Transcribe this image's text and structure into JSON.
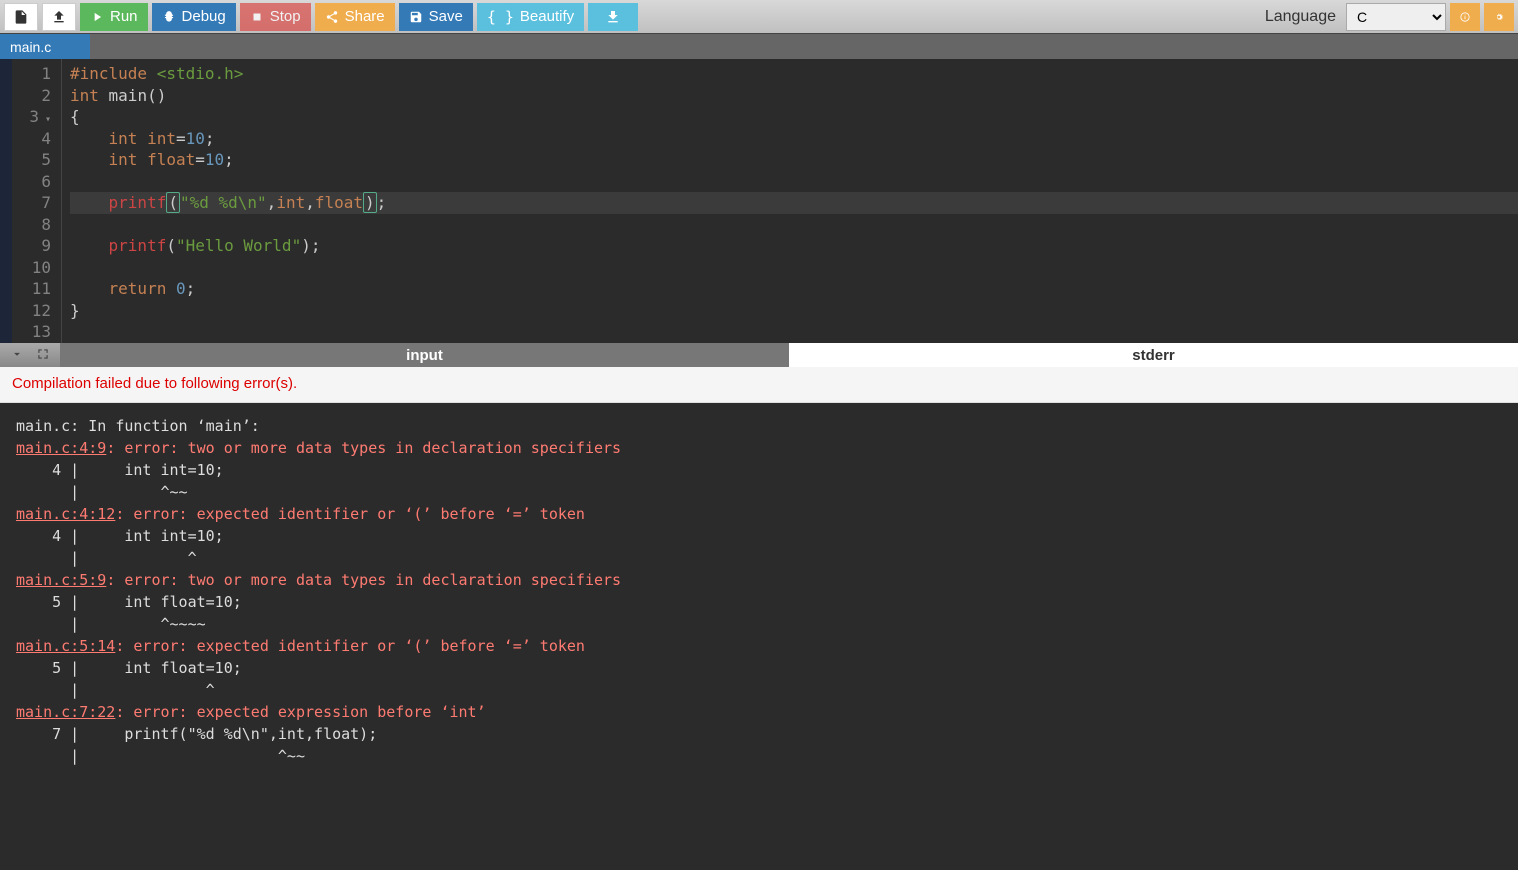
{
  "toolbar": {
    "run": "Run",
    "debug": "Debug",
    "stop": "Stop",
    "share": "Share",
    "save": "Save",
    "beautify": "Beautify",
    "language_label": "Language",
    "language_value": "C"
  },
  "tabs": {
    "file": "main.c"
  },
  "editor": {
    "line_numbers": [
      "1",
      "2",
      "3",
      "4",
      "5",
      "6",
      "7",
      "8",
      "9",
      "10",
      "11",
      "12",
      "13"
    ],
    "code_tokens": [
      [
        {
          "t": "#include",
          "c": "tok-pp"
        },
        {
          "t": " ",
          "c": ""
        },
        {
          "t": "<stdio.h>",
          "c": "tok-include"
        }
      ],
      [
        {
          "t": "int",
          "c": "tok-kw"
        },
        {
          "t": " main()",
          "c": ""
        }
      ],
      [
        {
          "t": "{",
          "c": ""
        }
      ],
      [
        {
          "t": "    ",
          "c": ""
        },
        {
          "t": "int",
          "c": "tok-kw"
        },
        {
          "t": " ",
          "c": ""
        },
        {
          "t": "int",
          "c": "tok-kw"
        },
        {
          "t": "=",
          "c": ""
        },
        {
          "t": "10",
          "c": "tok-num"
        },
        {
          "t": ";",
          "c": ""
        }
      ],
      [
        {
          "t": "    ",
          "c": ""
        },
        {
          "t": "int",
          "c": "tok-kw"
        },
        {
          "t": " ",
          "c": ""
        },
        {
          "t": "float",
          "c": "tok-kw"
        },
        {
          "t": "=",
          "c": ""
        },
        {
          "t": "10",
          "c": "tok-num"
        },
        {
          "t": ";",
          "c": ""
        }
      ],
      [],
      [
        {
          "t": "    ",
          "c": ""
        },
        {
          "t": "printf",
          "c": "tok-fn"
        },
        {
          "t": "(",
          "c": "paren-hl"
        },
        {
          "t": "\"%d %d\\n\"",
          "c": "tok-str"
        },
        {
          "t": ",",
          "c": ""
        },
        {
          "t": "int",
          "c": "tok-kw"
        },
        {
          "t": ",",
          "c": ""
        },
        {
          "t": "float",
          "c": "tok-kw"
        },
        {
          "t": ")",
          "c": "paren-hl"
        },
        {
          "t": ";",
          "c": ""
        }
      ],
      [],
      [
        {
          "t": "    ",
          "c": ""
        },
        {
          "t": "printf",
          "c": "tok-fn"
        },
        {
          "t": "(",
          "c": ""
        },
        {
          "t": "\"Hello World\"",
          "c": "tok-str"
        },
        {
          "t": ");",
          "c": ""
        }
      ],
      [],
      [
        {
          "t": "    ",
          "c": ""
        },
        {
          "t": "return",
          "c": "tok-kw"
        },
        {
          "t": " ",
          "c": ""
        },
        {
          "t": "0",
          "c": "tok-num"
        },
        {
          "t": ";",
          "c": ""
        }
      ],
      [
        {
          "t": "}",
          "c": ""
        }
      ],
      []
    ],
    "highlight_line": 7
  },
  "lower_tabs": {
    "input": "input",
    "stderr": "stderr"
  },
  "error_banner": "Compilation failed due to following error(s).",
  "output_lines": [
    {
      "type": "plain",
      "text": "main.c: In function ‘main’:"
    },
    {
      "type": "err",
      "loc": "main.c:4:9",
      "rest": ": error: two or more data types in declaration specifiers"
    },
    {
      "type": "plain",
      "text": "    4 |     int int=10;"
    },
    {
      "type": "plain",
      "text": "      |         ^~~"
    },
    {
      "type": "err",
      "loc": "main.c:4:12",
      "rest": ": error: expected identifier or ‘(’ before ‘=’ token"
    },
    {
      "type": "plain",
      "text": "    4 |     int int=10;"
    },
    {
      "type": "plain",
      "text": "      |            ^"
    },
    {
      "type": "err",
      "loc": "main.c:5:9",
      "rest": ": error: two or more data types in declaration specifiers"
    },
    {
      "type": "plain",
      "text": "    5 |     int float=10;"
    },
    {
      "type": "plain",
      "text": "      |         ^~~~~"
    },
    {
      "type": "err",
      "loc": "main.c:5:14",
      "rest": ": error: expected identifier or ‘(’ before ‘=’ token"
    },
    {
      "type": "plain",
      "text": "    5 |     int float=10;"
    },
    {
      "type": "plain",
      "text": "      |              ^"
    },
    {
      "type": "err",
      "loc": "main.c:7:22",
      "rest": ": error: expected expression before ‘int’"
    },
    {
      "type": "plain",
      "text": "    7 |     printf(\"%d %d\\n\",int,float);"
    },
    {
      "type": "plain",
      "text": "      |                      ^~~"
    }
  ]
}
